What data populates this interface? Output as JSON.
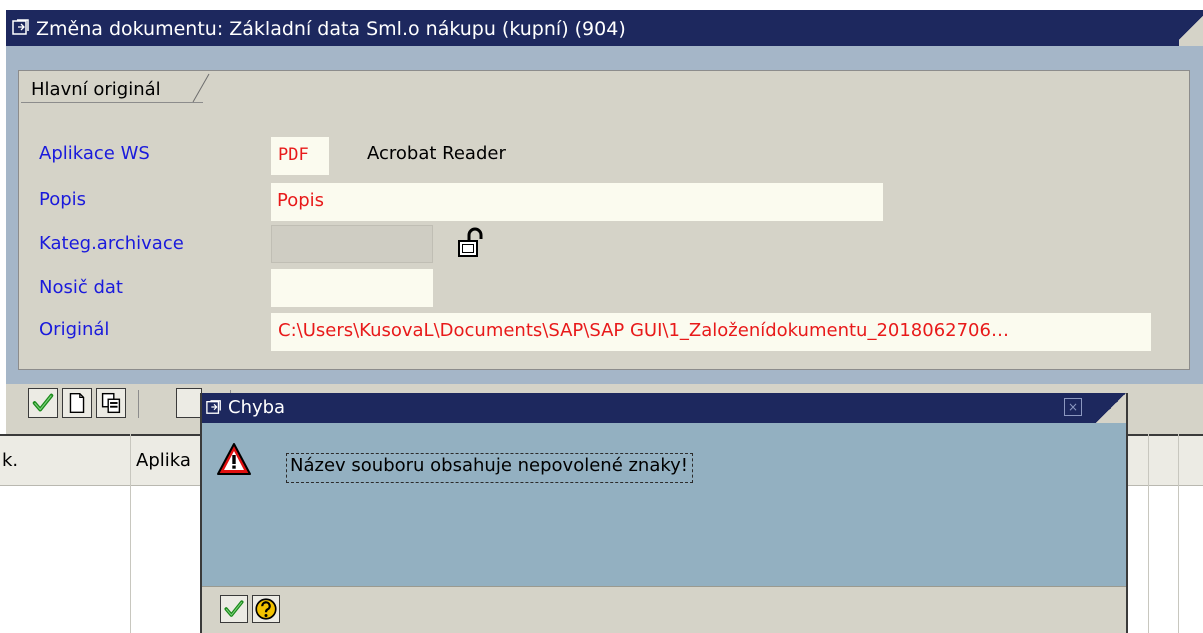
{
  "window": {
    "title": "Změna dokumentu: Základní data Sml.o nákupu (kupní) (904)"
  },
  "group": {
    "tab_label": "Hlavní originál"
  },
  "fields": {
    "ws_app": {
      "label": "Aplikace WS",
      "code": "PDF",
      "name": "Acrobat Reader"
    },
    "popis": {
      "label": "Popis",
      "value": "Popis"
    },
    "kategorie": {
      "label": "Kateg.archivace",
      "value": ""
    },
    "nosic": {
      "label": "Nosič dat",
      "value": ""
    },
    "original": {
      "label": "Originál",
      "value": "C:\\Users\\KusovaL\\Documents\\SAP\\SAP GUI\\1_Založenídokumentu_2018062706…"
    }
  },
  "table": {
    "columns": [
      "k.",
      "Aplika"
    ]
  },
  "dialog": {
    "title": "Chyba",
    "message": "Název souboru obsahuje nepovolené znaky!",
    "close_glyph": "×"
  },
  "icons": {
    "window": "window-icon",
    "lock": "lock-icon",
    "confirm": "checkmark-icon",
    "new": "new-document-icon",
    "copy": "copy-icon",
    "warning": "warning-icon",
    "help": "help-icon"
  },
  "colors": {
    "titlebar": "#1d285e",
    "panel": "#d5d3c8",
    "label_blue": "#1a1adc",
    "value_red": "#e81a1a",
    "dialog_body": "#93b0c1"
  }
}
